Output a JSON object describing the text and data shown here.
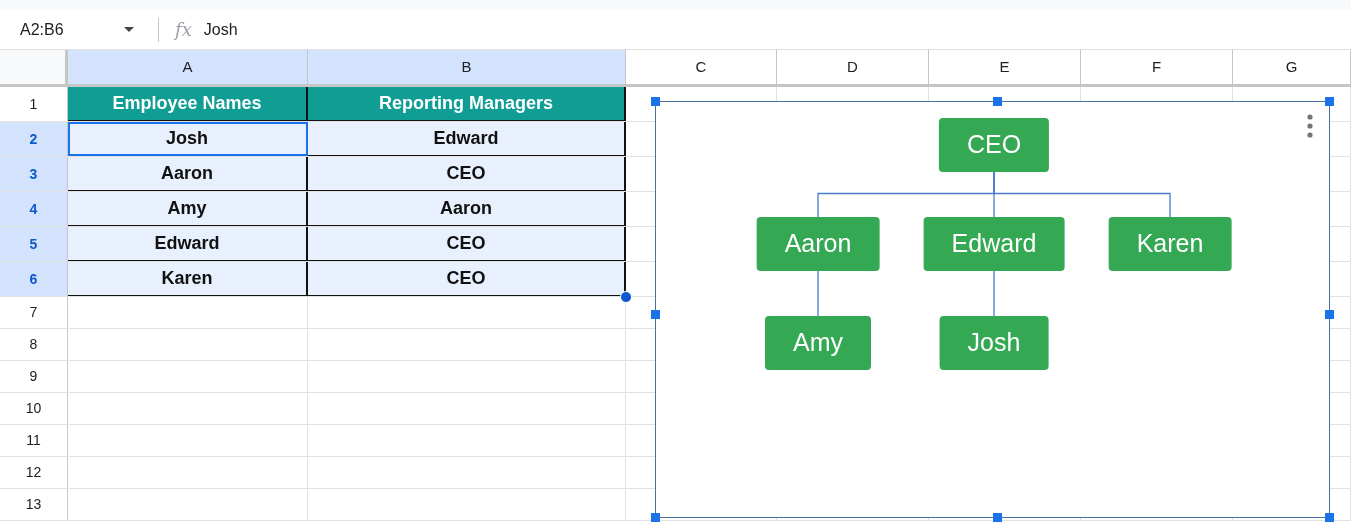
{
  "formula_bar": {
    "name_box": "A2:B6",
    "fx": "fx",
    "value": "Josh"
  },
  "columns": [
    {
      "label": "A",
      "selected": true
    },
    {
      "label": "B",
      "selected": true
    },
    {
      "label": "C",
      "selected": false
    },
    {
      "label": "D",
      "selected": false
    },
    {
      "label": "E",
      "selected": false
    },
    {
      "label": "F",
      "selected": false
    },
    {
      "label": "G",
      "selected": false
    }
  ],
  "rows": [
    {
      "number": "1",
      "kind": "header",
      "selected": false,
      "cells": [
        {
          "text": "Employee Names",
          "active": false
        },
        {
          "text": "Reporting Managers",
          "active": false
        }
      ]
    },
    {
      "number": "2",
      "kind": "data",
      "selected": true,
      "cells": [
        {
          "text": "Josh",
          "active": true
        },
        {
          "text": "Edward",
          "active": false
        }
      ]
    },
    {
      "number": "3",
      "kind": "data",
      "selected": true,
      "cells": [
        {
          "text": "Aaron",
          "active": false
        },
        {
          "text": "CEO",
          "active": false
        }
      ]
    },
    {
      "number": "4",
      "kind": "data",
      "selected": true,
      "cells": [
        {
          "text": "Amy",
          "active": false
        },
        {
          "text": "Aaron",
          "active": false
        }
      ]
    },
    {
      "number": "5",
      "kind": "data",
      "selected": true,
      "cells": [
        {
          "text": "Edward",
          "active": false
        },
        {
          "text": "CEO",
          "active": false
        }
      ]
    },
    {
      "number": "6",
      "kind": "data",
      "selected": true,
      "cells": [
        {
          "text": "Karen",
          "active": false
        },
        {
          "text": "CEO",
          "active": false
        }
      ]
    },
    {
      "number": "7",
      "kind": "empty",
      "selected": false
    },
    {
      "number": "8",
      "kind": "empty",
      "selected": false
    },
    {
      "number": "9",
      "kind": "empty",
      "selected": false
    },
    {
      "number": "10",
      "kind": "empty",
      "selected": false
    },
    {
      "number": "11",
      "kind": "empty",
      "selected": false
    },
    {
      "number": "12",
      "kind": "empty",
      "selected": false
    },
    {
      "number": "13",
      "kind": "empty",
      "selected": false
    }
  ],
  "org_chart": {
    "selected": true,
    "root": {
      "label": "CEO",
      "children": [
        {
          "label": "Aaron",
          "children": [
            {
              "label": "Amy"
            }
          ]
        },
        {
          "label": "Edward",
          "children": [
            {
              "label": "Josh"
            }
          ]
        },
        {
          "label": "Karen"
        }
      ]
    }
  }
}
